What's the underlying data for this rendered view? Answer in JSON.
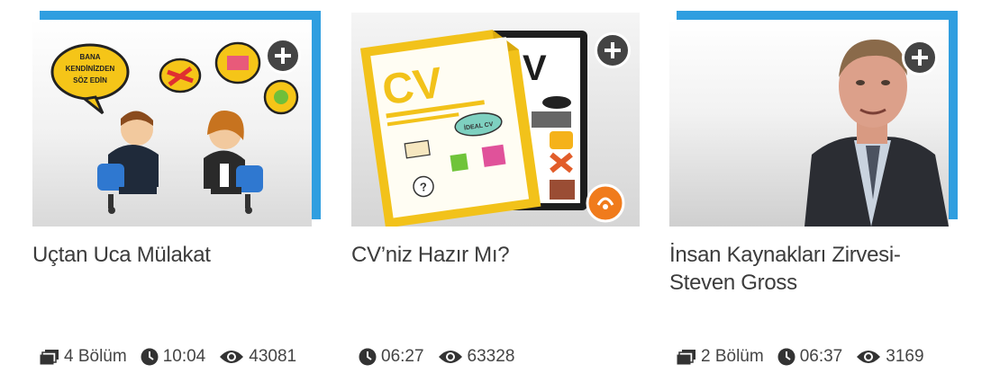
{
  "cards": [
    {
      "title": "Uçtan Uca Mülakat",
      "episodes": "4 Bölüm",
      "duration": "10:04",
      "views": "43081",
      "bubble_text_line1": "BANA",
      "bubble_text_line2": "KENDİNİZDEN",
      "bubble_text_line3": "SÖZ EDİN"
    },
    {
      "title": "CV’niz Hazır Mı?",
      "duration": "06:27",
      "views": "63328",
      "doc_label": "CV",
      "doc_tag": "İDEAL CV",
      "back_label": "V"
    },
    {
      "title": "İnsan Kaynakları Zirvesi-Steven Gross",
      "episodes": "2 Bölüm",
      "duration": "06:37",
      "views": "3169"
    }
  ],
  "colors": {
    "accent_blue": "#2f9ee0",
    "cv_yellow": "#f2c21a",
    "badge_orange": "#f07b1c",
    "icon_dark": "#333333"
  }
}
